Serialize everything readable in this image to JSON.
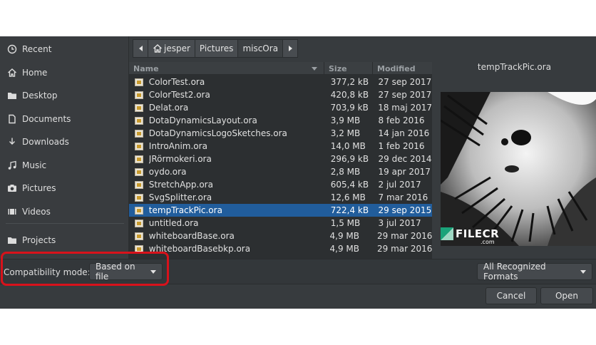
{
  "sidebar": {
    "items": [
      {
        "label": "Recent",
        "icon": "clock-icon"
      },
      {
        "label": "Home",
        "icon": "home-icon"
      },
      {
        "label": "Desktop",
        "icon": "folder-icon"
      },
      {
        "label": "Documents",
        "icon": "document-icon"
      },
      {
        "label": "Downloads",
        "icon": "download-icon"
      },
      {
        "label": "Music",
        "icon": "music-icon"
      },
      {
        "label": "Pictures",
        "icon": "camera-icon"
      },
      {
        "label": "Videos",
        "icon": "film-icon"
      },
      {
        "label": "Projects",
        "icon": "folder-icon"
      }
    ]
  },
  "pathbar": {
    "segments": [
      "jesper",
      "Pictures",
      "miscOra"
    ],
    "active_segment": "miscOra"
  },
  "list": {
    "headers": {
      "name": "Name",
      "size": "Size",
      "modified": "Modified"
    },
    "rows": [
      {
        "name": "ColorTest.ora",
        "size": "377,2 kB",
        "modified": "27 sep 2017"
      },
      {
        "name": "ColorTest2.ora",
        "size": "420,8 kB",
        "modified": "27 sep 2017"
      },
      {
        "name": "Delat.ora",
        "size": "703,9 kB",
        "modified": "18 maj 2017"
      },
      {
        "name": "DotaDynamicsLayout.ora",
        "size": "3,9 MB",
        "modified": "8 feb 2016"
      },
      {
        "name": "DotaDynamicsLogoSketches.ora",
        "size": "3,2 MB",
        "modified": "14 jan 2016"
      },
      {
        "name": "IntroAnim.ora",
        "size": "14,0 MB",
        "modified": "1 feb 2016"
      },
      {
        "name": "JRörmokeri.ora",
        "size": "296,9 kB",
        "modified": "29 dec 2014"
      },
      {
        "name": "oydo.ora",
        "size": "2,8 MB",
        "modified": "19 apr 2017"
      },
      {
        "name": "StretchApp.ora",
        "size": "605,4 kB",
        "modified": "2 jul 2017"
      },
      {
        "name": "SvgSplitter.ora",
        "size": "12,6 MB",
        "modified": "7 mar 2016"
      },
      {
        "name": "tempTrackPic.ora",
        "size": "722,4 kB",
        "modified": "29 sep 2015"
      },
      {
        "name": "untitled.ora",
        "size": "1,5 MB",
        "modified": "3 jul 2017"
      },
      {
        "name": "whiteboardBase.ora",
        "size": "4,9 MB",
        "modified": "29 mar 2016"
      },
      {
        "name": "whiteboardBasebkp.ora",
        "size": "4,9 MB",
        "modified": "29 mar 2016"
      }
    ],
    "selected": "tempTrackPic.ora"
  },
  "preview": {
    "title": "tempTrackPic.ora",
    "watermark": "FILECR",
    "watermark_sub": ".com"
  },
  "options": {
    "compat_label": "Compatibility mode:",
    "compat_value": "Based on file",
    "format_value": "All Recognized Formats"
  },
  "buttons": {
    "cancel": "Cancel",
    "open": "Open"
  },
  "colors": {
    "selection": "#215d9c",
    "highlight_annotation": "#d8121b"
  }
}
